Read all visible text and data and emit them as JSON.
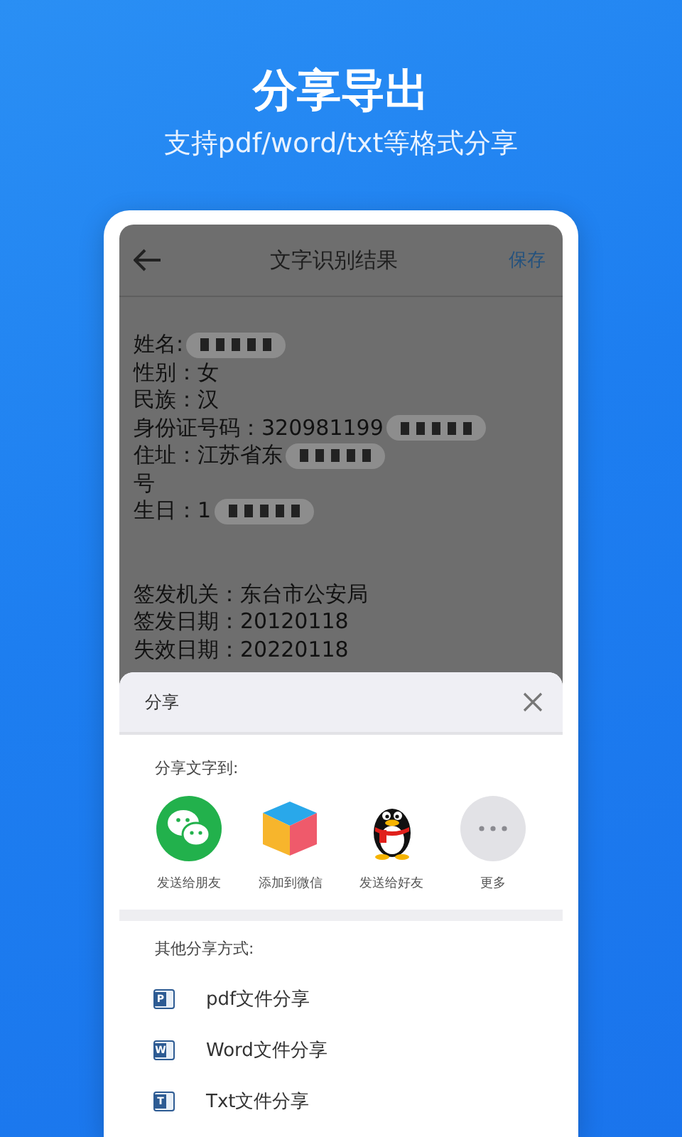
{
  "promo": {
    "title": "分享导出",
    "subtitle": "支持pdf/word/txt等格式分享"
  },
  "app_bar": {
    "title": "文字识别结果",
    "action": "保存"
  },
  "fields": [
    {
      "text": "姓名:",
      "redacted": true
    },
    {
      "text": "性别：女",
      "redacted": false
    },
    {
      "text": "民族：汉",
      "redacted": false
    },
    {
      "text": "身份证号码：320981199",
      "redacted": true
    },
    {
      "text": "住址：江苏省东",
      "redacted": true
    },
    {
      "text": "号",
      "redacted": false
    },
    {
      "text": "生日：1",
      "redacted": true
    }
  ],
  "issue_fields": [
    {
      "text": "签发机关：东台市公安局"
    },
    {
      "text": "签发日期：20120118"
    },
    {
      "text": "失效日期：20220118"
    }
  ],
  "share_sheet": {
    "title": "分享",
    "section_label": "分享文字到:",
    "targets": [
      {
        "kind": "chat",
        "label": "发送给朋友"
      },
      {
        "kind": "cube",
        "label": "添加到微信"
      },
      {
        "kind": "penguin",
        "label": "发送给好友"
      },
      {
        "kind": "more",
        "label": "更多"
      }
    ],
    "other_label": "其他分享方式:",
    "file_options": [
      {
        "icon_letter": "P",
        "label": "pdf文件分享"
      },
      {
        "icon_letter": "W",
        "label": "Word文件分享"
      },
      {
        "icon_letter": "T",
        "label": "Txt文件分享"
      }
    ]
  }
}
